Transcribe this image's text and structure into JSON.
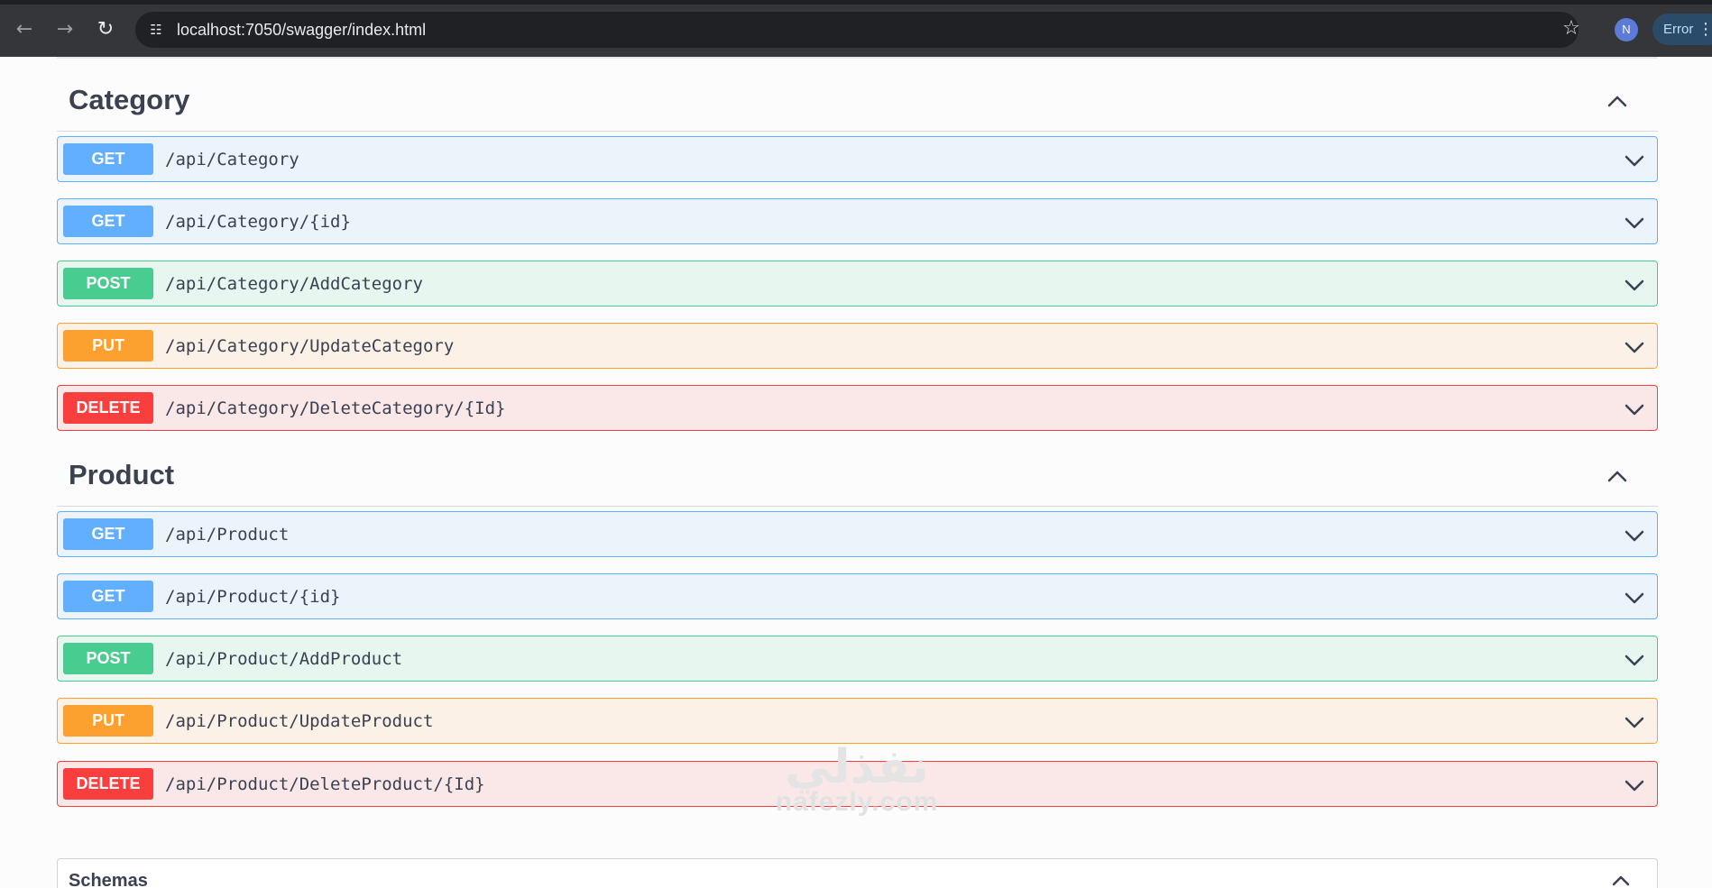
{
  "browser": {
    "url": "localhost:7050/swagger/index.html",
    "profile_initial": "N",
    "error_label": "Error",
    "icons": {
      "back": "arrow-left-icon",
      "forward": "arrow-right-icon",
      "reload": "reload-icon",
      "site_info": "site-info-icon",
      "bookmark": "star-icon",
      "menu": "more-vert-icon"
    }
  },
  "tags": [
    {
      "name": "Category",
      "operations": [
        {
          "method": "GET",
          "path": "/api/Category"
        },
        {
          "method": "GET",
          "path": "/api/Category/{id}"
        },
        {
          "method": "POST",
          "path": "/api/Category/AddCategory"
        },
        {
          "method": "PUT",
          "path": "/api/Category/UpdateCategory"
        },
        {
          "method": "DELETE",
          "path": "/api/Category/DeleteCategory/{Id}"
        }
      ]
    },
    {
      "name": "Product",
      "operations": [
        {
          "method": "GET",
          "path": "/api/Product"
        },
        {
          "method": "GET",
          "path": "/api/Product/{id}"
        },
        {
          "method": "POST",
          "path": "/api/Product/AddProduct"
        },
        {
          "method": "PUT",
          "path": "/api/Product/UpdateProduct"
        },
        {
          "method": "DELETE",
          "path": "/api/Product/DeleteProduct/{Id}"
        }
      ]
    }
  ],
  "schemas": {
    "title": "Schemas"
  },
  "watermark": {
    "arabic": "نفذلي",
    "latin": "nafezly.com"
  },
  "colors": {
    "get": "#61affe",
    "post": "#49cc90",
    "put": "#fca130",
    "delete": "#f93e3e",
    "text": "#3b4151"
  }
}
